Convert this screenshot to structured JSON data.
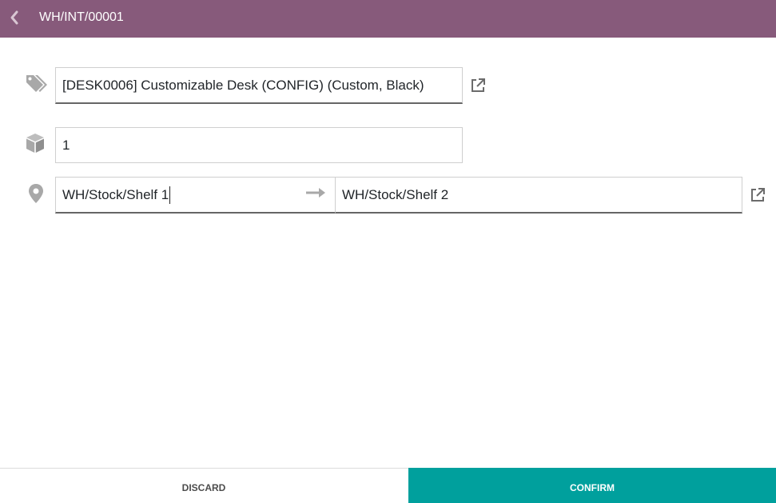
{
  "header": {
    "title": "WH/INT/00001",
    "back_icon": "chevron-left-icon"
  },
  "product": {
    "icon": "tags-icon",
    "value": "[DESK0006] Customizable Desk (CONFIG) (Custom, Black)",
    "link_icon": "external-link-icon"
  },
  "quantity": {
    "icon": "cube-icon",
    "value": "1"
  },
  "location": {
    "icon": "map-marker-icon",
    "source": "WH/Stock/Shelf 1",
    "arrow_icon": "arrow-right-icon",
    "destination": "WH/Stock/Shelf 2",
    "link_icon": "external-link-icon"
  },
  "footer": {
    "discard_label": "DISCARD",
    "confirm_label": "CONFIRM"
  },
  "colors": {
    "header_bg": "#875a7b",
    "confirm_bg": "#00a09d",
    "icon_gray": "#a8a8a8"
  }
}
